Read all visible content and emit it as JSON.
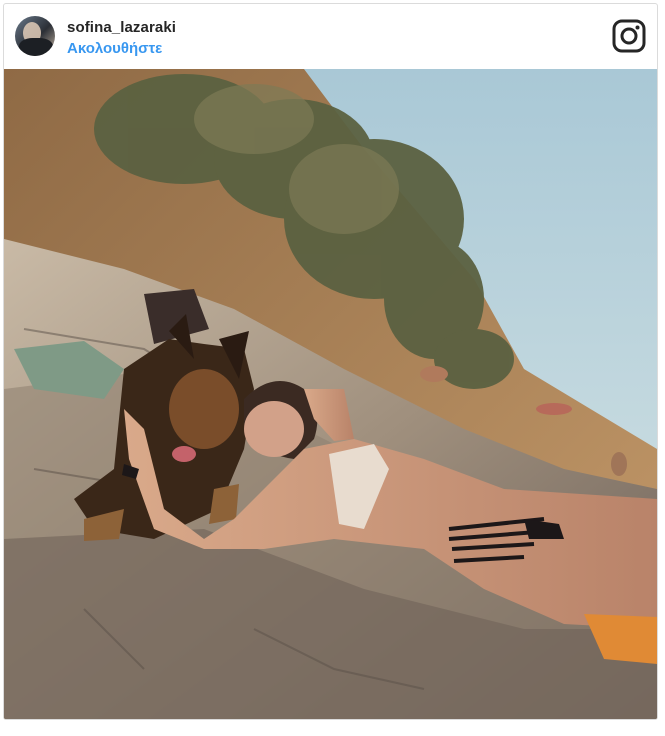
{
  "post": {
    "username": "sofina_lazaraki",
    "follow_label": "Ακολουθήστε",
    "brand_icon": "instagram-icon",
    "photo": {
      "description_icon": "photo",
      "colors": {
        "sky": "#b8d2dd",
        "rock": "#a8998a",
        "hill": "#a07a55",
        "tree": "#5a6440"
      }
    }
  },
  "colors": {
    "link": "#3897f0",
    "text": "#262626",
    "border": "#dbdbdb"
  }
}
